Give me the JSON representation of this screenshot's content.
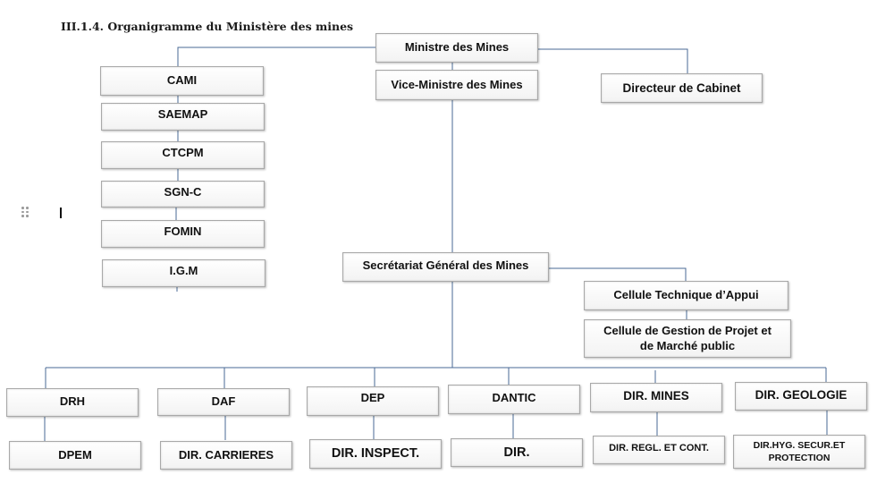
{
  "title": "III.1.4. Organigramme du Ministère des mines",
  "nodes": {
    "ministre": "Ministre des Mines",
    "vice_ministre": "Vice-Ministre des Mines",
    "directeur_cabinet": "Directeur de Cabinet",
    "left_column": [
      "CAMI",
      "SAEMAP",
      "CTCPM",
      "SGN-C",
      "FOMIN",
      "I.G.M"
    ],
    "secretariat": "Secrétariat Général des Mines",
    "cellule_technique": "Cellule Technique d’Appui",
    "cellule_gestion": "Cellule de Gestion de Projet et de Marché public",
    "directions": [
      {
        "name": "DRH",
        "sub": "DPEM"
      },
      {
        "name": "DAF",
        "sub": "DIR. CARRIERES"
      },
      {
        "name": "DEP",
        "sub": "DIR. INSPECT."
      },
      {
        "name": "DANTIC",
        "sub": "DIR."
      },
      {
        "name": "DIR. MINES",
        "sub": "DIR. REGL. ET CONT."
      },
      {
        "name": "DIR. GEOLOGIE",
        "sub": "DIR.HYG. SECUR.ET PROTECTION"
      }
    ]
  },
  "colors": {
    "connector": "#4a6a95",
    "box_border": "#a9a9a9"
  }
}
